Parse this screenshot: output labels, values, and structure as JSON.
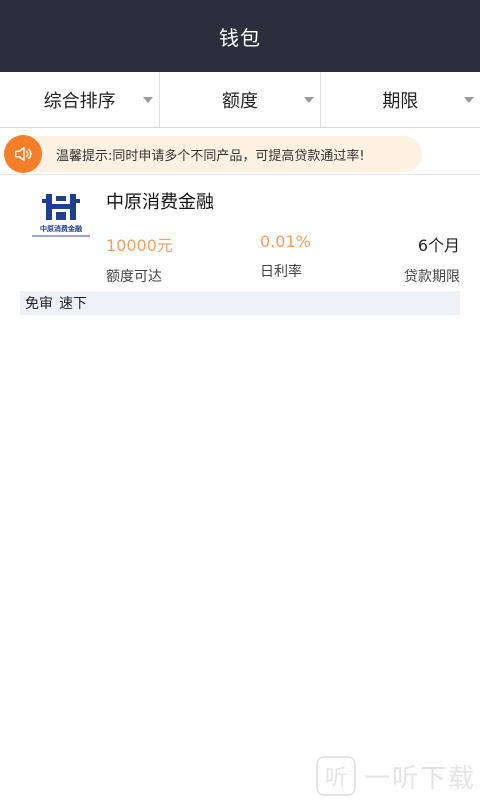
{
  "header": {
    "title": "钱包"
  },
  "filters": [
    {
      "label": "综合排序",
      "icon": "caret-down-icon"
    },
    {
      "label": "额度",
      "icon": "caret-down-icon"
    },
    {
      "label": "期限",
      "icon": "caret-down-icon"
    }
  ],
  "notice": {
    "icon": "speaker-icon",
    "text": "温馨提示:同时申请多个不同产品，可提高贷款通过率!"
  },
  "products": [
    {
      "name": "中原消费金融",
      "logo_caption": "中原消费金融",
      "amount": {
        "value": "10000元",
        "label": "额度可达"
      },
      "rate": {
        "value": "0.01%",
        "label": "日利率"
      },
      "term": {
        "value": "6个月",
        "label": "贷款期限"
      },
      "tags": [
        "免审",
        "速下"
      ]
    }
  ],
  "watermark": {
    "badge": "听",
    "text": "一听下载"
  },
  "colors": {
    "header_bg": "#2b2f3c",
    "accent": "#f57f29",
    "value_orange": "#f0a060",
    "tag_bg": "#eef2f7"
  }
}
